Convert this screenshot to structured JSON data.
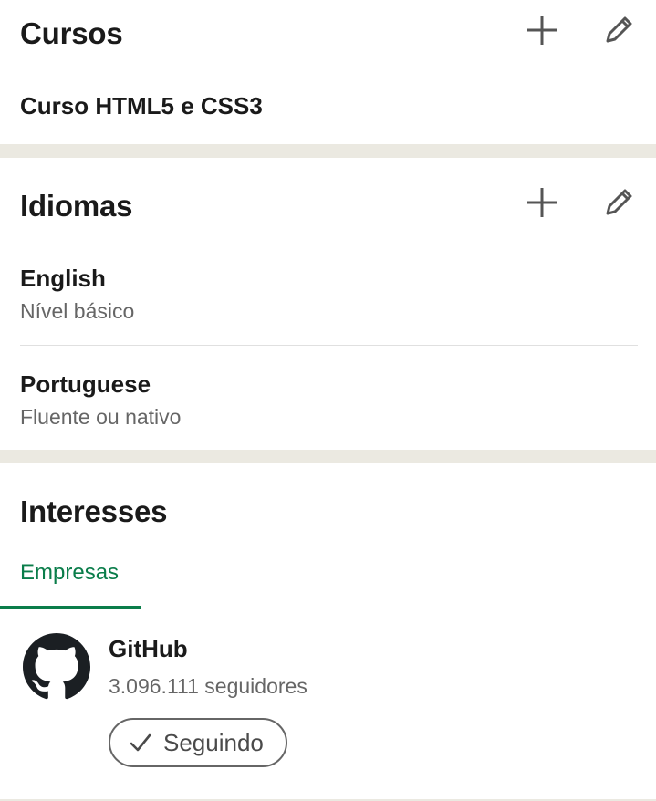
{
  "courses": {
    "title": "Cursos",
    "items": [
      {
        "name": "Curso HTML5 e CSS3"
      }
    ],
    "add_icon": "plus-icon",
    "edit_icon": "pencil-icon"
  },
  "languages": {
    "title": "Idiomas",
    "items": [
      {
        "name": "English",
        "level": "Nível básico"
      },
      {
        "name": "Portuguese",
        "level": "Fluente ou nativo"
      }
    ],
    "add_icon": "plus-icon",
    "edit_icon": "pencil-icon"
  },
  "interests": {
    "title": "Interesses",
    "tabs": [
      {
        "label": "Empresas",
        "active": true
      }
    ],
    "companies": [
      {
        "name": "GitHub",
        "followers": "3.096.111 seguidores",
        "follow_label": "Seguindo",
        "logo_icon": "github-logo-icon"
      }
    ]
  },
  "colors": {
    "accent_green": "#0a7d4a",
    "divider": "#ebe9e1",
    "text_primary": "#1a1a1a",
    "text_secondary": "#666666",
    "icon_gray": "#555555"
  }
}
